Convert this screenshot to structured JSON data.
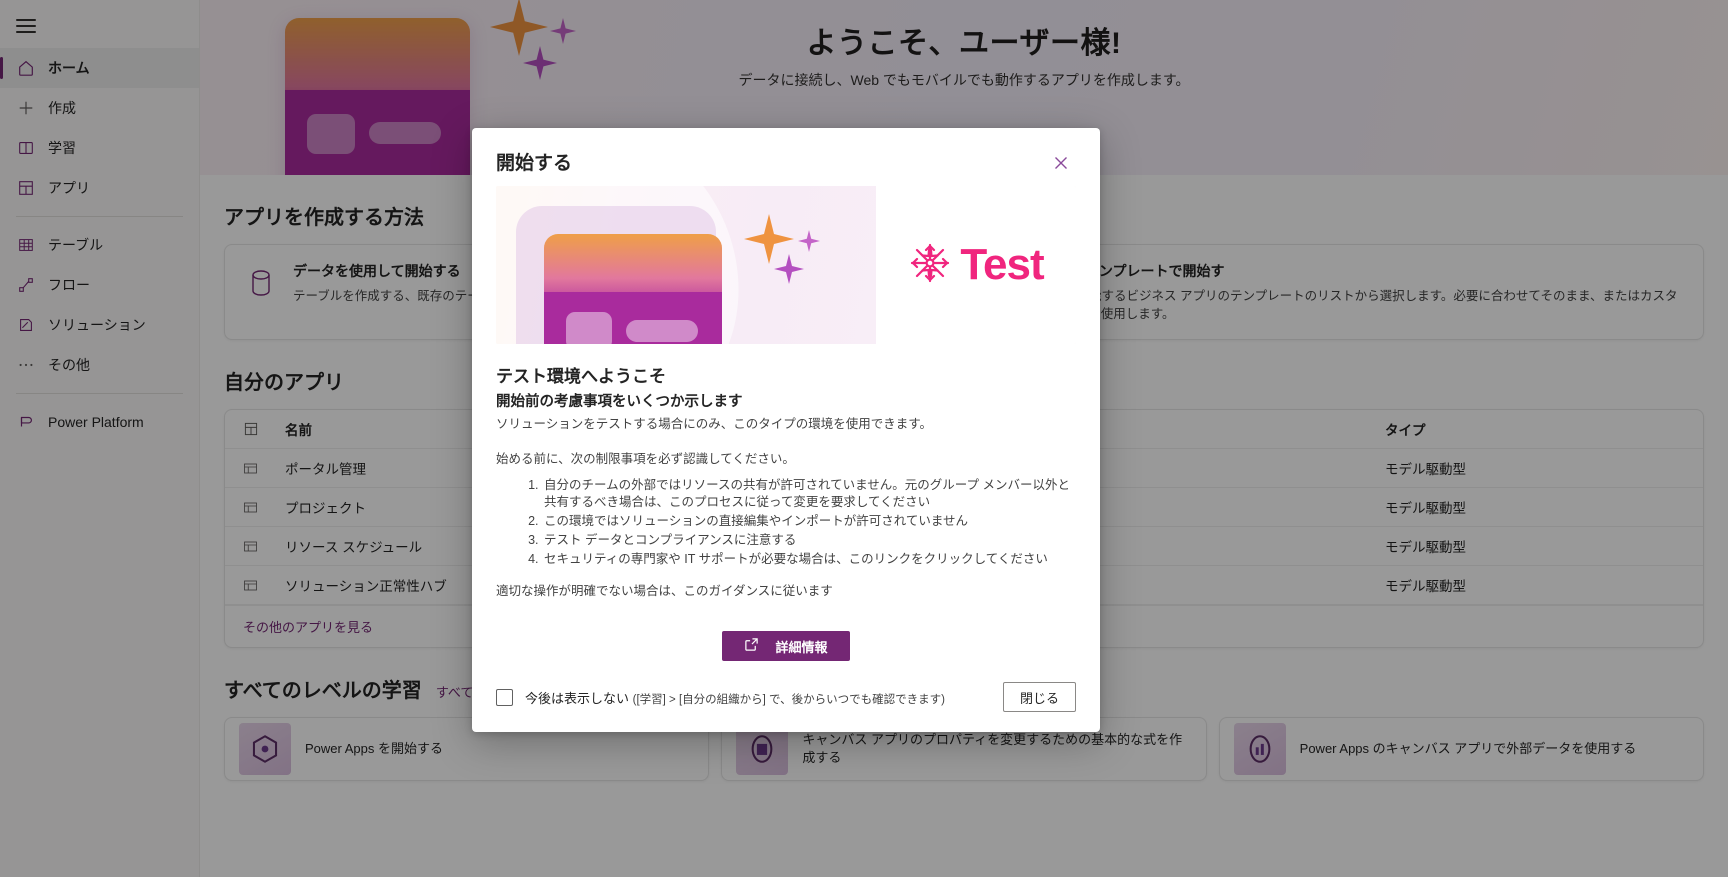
{
  "sidebar": {
    "hamburger_label": "menu",
    "items": [
      {
        "label": "ホーム",
        "icon": "home-icon",
        "active": true
      },
      {
        "label": "作成",
        "icon": "plus-icon",
        "active": false
      },
      {
        "label": "学習",
        "icon": "book-icon",
        "active": false
      },
      {
        "label": "アプリ",
        "icon": "apps-grid-icon",
        "active": false
      },
      {
        "label": "テーブル",
        "icon": "table-icon",
        "active": false
      },
      {
        "label": "フロー",
        "icon": "flow-icon",
        "active": false
      },
      {
        "label": "ソリューション",
        "icon": "solution-icon",
        "active": false
      },
      {
        "label": "その他",
        "icon": "ellipsis-icon",
        "active": false
      },
      {
        "label": "Power Platform",
        "icon": "power-platform-icon",
        "active": false
      }
    ]
  },
  "hero": {
    "title": "ようこそ、ユーザー様!",
    "subtitle": "データに接続し、Web でもモバイルでも動作するアプリを作成します。"
  },
  "how_to": {
    "heading": "アプリを作成する方法",
    "cards": [
      {
        "icon": "database-icon",
        "title": "データを使用して開始する",
        "desc": "テーブルを作成する、既存のテーブルを選択する、アプリを作成します。"
      },
      {
        "icon": "template-icon",
        "title": "アプリ テンプレートで開始す",
        "desc": "完全に機能するビジネス アプリのテンプレートのリストから選択します。必要に合わせてそのまま、またはカスタマイズして使用します。"
      }
    ]
  },
  "my_apps": {
    "heading": "自分のアプリ",
    "columns": {
      "name": "名前",
      "type": "タイプ"
    },
    "rows": [
      {
        "name": "ポータル管理",
        "type": "モデル駆動型"
      },
      {
        "name": "プロジェクト",
        "type": "モデル駆動型"
      },
      {
        "name": "リソース スケジュール",
        "type": "モデル駆動型"
      },
      {
        "name": "ソリューション正常性ハブ",
        "type": "モデル駆動型"
      }
    ],
    "more_link": "その他のアプリを見る"
  },
  "learning": {
    "heading": "すべてのレベルの学習",
    "see_all": "すべて表示",
    "cards": [
      {
        "title": "Power Apps を開始する"
      },
      {
        "title": "キャンバス アプリのプロパティを変更するための基本的な式を作成する"
      },
      {
        "title": "Power Apps のキャンバス アプリで外部データを使用する"
      }
    ]
  },
  "modal": {
    "title": "開始する",
    "close_icon": "close-icon",
    "banner_logo_text": "Test",
    "banner_logo_icon": "snowflake-icon",
    "heading": "テスト環境へようこそ",
    "subheading": "開始前の考慮事項をいくつか示します",
    "intro": "ソリューションをテストする場合にのみ、このタイプの環境を使用できます。",
    "before_start": "始める前に、次の制限事項を必ず認識してください。",
    "limits": [
      "自分のチームの外部ではリソースの共有が許可されていません。元のグループ メンバー以外と共有するべき場合は、このプロセスに従って変更を要求してください",
      "この環境ではソリューションの直接編集やインポートが許可されていません",
      "テスト データとコンプライアンスに注意する",
      "セキュリティの専門家や IT サポートが必要な場合は、このリンクをクリックしてください"
    ],
    "closing": "適切な操作が明確でない場合は、このガイダンスに従います",
    "learn_more_button": "詳細情報",
    "learn_more_icon": "external-link-icon",
    "dont_show_label": "今後は表示しない",
    "dont_show_paren": "([学習] > [自分の組織から] で、後からいつでも確認できます)",
    "close_button": "閉じる"
  },
  "colors": {
    "accent_purple": "#742774",
    "logo_pink": "#f0257e",
    "link_purple": "#742774"
  }
}
